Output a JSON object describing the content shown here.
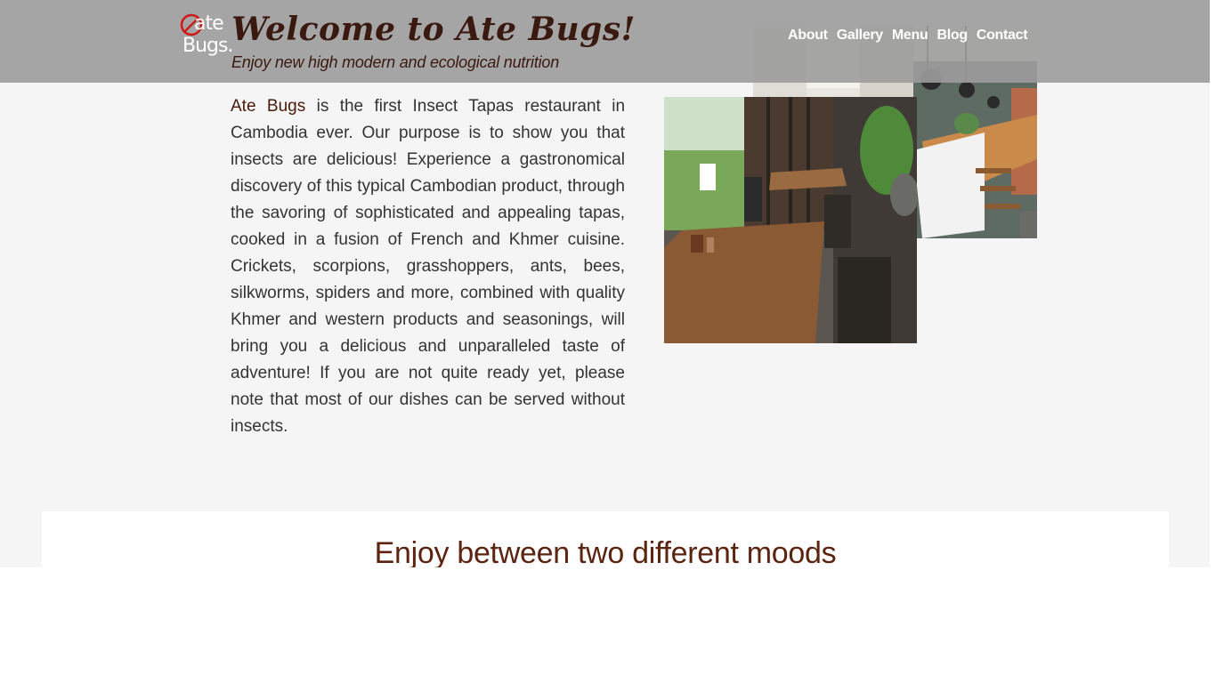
{
  "header": {
    "logo_top": "ate",
    "logo_bottom": "Bugs.",
    "title": "Welcome to Ate Bugs!",
    "tagline": "Enjoy new high modern and ecological nutrition"
  },
  "nav": {
    "items": [
      "About",
      "Gallery",
      "Menu",
      "Blog",
      "Contact"
    ]
  },
  "intro": {
    "brand": "Ate Bugs",
    "text": " is the first Insect Tapas restaurant in Cambodia ever. Our purpose is to show you that insects are delicious! Experience a gastronomical discovery of this typical Cambodian product, through the savoring of sophisticated and appealing tapas, cooked in a fusion of French and Khmer cuisine. Crickets, scorpions, grasshoppers, ants, bees, silkworms, spiders and more, combined with quality Khmer and western products and seasonings, will bring you a delicious and unparalleled taste of adventure! If you are not quite ready yet, please note that most of our dishes can be served without insects."
  },
  "moods": {
    "heading": "Enjoy between two different moods"
  },
  "colors": {
    "header_bg": "#9c9c9c",
    "title": "#3a1a10",
    "brand": "#4a1a08",
    "heading": "#5c2410",
    "page_bg": "#f5f5f5"
  }
}
